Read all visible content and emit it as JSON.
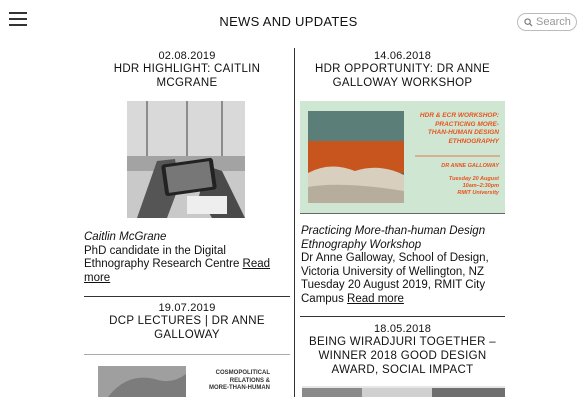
{
  "header": {
    "title": "NEWS AND UPDATES",
    "search_placeholder": "Search",
    "menu_icon": "hamburger-icon",
    "search_icon": "magnifier-icon"
  },
  "left_column": {
    "post1": {
      "date": "02.08.2019",
      "headline_line1": "HDR HIGHLIGHT: CAITLIN",
      "headline_line2": "MCGRANE",
      "caption_name": "Caitlin McGrane",
      "caption_line1": "PhD candidate in the Digital",
      "caption_line2": "Ethnography Research Centre",
      "read_more": "Read",
      "read_more_2": "more"
    },
    "post2": {
      "date": "19.07.2019",
      "headline_line1": "DCP LECTURES | DR ANNE",
      "headline_line2": "GALLOWAY",
      "poster_line1": "COSMOPOLITICAL",
      "poster_line2": "RELATIONS &",
      "poster_line3": "MORE-THAN-HUMAN"
    }
  },
  "right_column": {
    "post1": {
      "date": "14.06.2018",
      "headline_line1": "HDR OPPORTUNITY: DR ANNE",
      "headline_line2": "GALLOWAY WORKSHOP",
      "poster_title1": "HDR & ECR WORKSHOP:",
      "poster_title2": "PRACTICING MORE-",
      "poster_title3": "THAN-HUMAN DESIGN",
      "poster_title4": "ETHNOGRAPHY",
      "poster_name": "DR ANNE GALLOWAY",
      "poster_date1": "Tuesday 20 August",
      "poster_date2": "10am–2:30pm",
      "poster_date3": "RMIT University",
      "caption_title1": "Practicing More-than-human Design",
      "caption_title2": "Ethnography Workshop",
      "caption_line1": "Dr Anne Galloway, School of Design,",
      "caption_line2": "Victoria University of Wellington, NZ",
      "caption_line3": "Tuesday 20 August 2019, RMIT City",
      "caption_line4": "Campus",
      "read_more": "Read more"
    },
    "post2": {
      "date": "18.05.2018",
      "headline_line1": "BEING WIRADJURI TOGETHER –",
      "headline_line2": "WINNER 2018 GOOD DESIGN",
      "headline_line3": "AWARD, SOCIAL IMPACT"
    }
  },
  "colors": {
    "poster_green": "#cfe6d2",
    "poster_orange": "#e8531f",
    "text": "#111111"
  }
}
